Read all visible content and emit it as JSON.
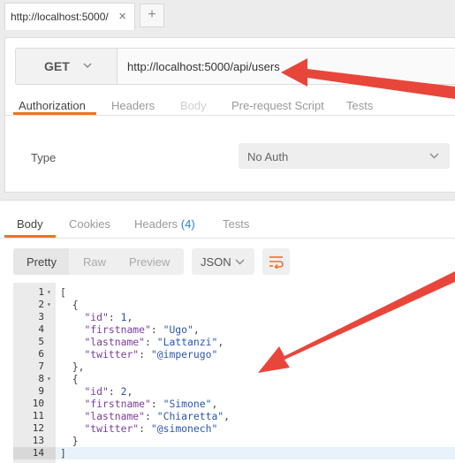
{
  "browser_tab": {
    "title": "http://localhost:5000/",
    "close": "×",
    "add": "+"
  },
  "request": {
    "method": "GET",
    "url": "http://localhost:5000/api/users",
    "tabs": [
      "Authorization",
      "Headers",
      "Body",
      "Pre-request Script",
      "Tests"
    ],
    "active_tab": "Authorization",
    "auth": {
      "type_label": "Type",
      "value": "No Auth"
    }
  },
  "response": {
    "tabs": {
      "body": "Body",
      "cookies": "Cookies",
      "headers": "Headers",
      "headers_count": "(4)",
      "tests": "Tests"
    },
    "active_tab": "Body",
    "view_modes": [
      "Pretty",
      "Raw",
      "Preview"
    ],
    "active_view": "Pretty",
    "format": "JSON",
    "lines": [
      {
        "n": "1",
        "text": "["
      },
      {
        "n": "2",
        "text": "  {"
      },
      {
        "n": "3",
        "key": "\"id\"",
        "val": "1",
        "tail": ","
      },
      {
        "n": "4",
        "key": "\"firstname\"",
        "val": "\"Ugo\"",
        "tail": ","
      },
      {
        "n": "5",
        "key": "\"lastname\"",
        "val": "\"Lattanzi\"",
        "tail": ","
      },
      {
        "n": "6",
        "key": "\"twitter\"",
        "val": "\"@imperugo\"",
        "tail": ""
      },
      {
        "n": "7",
        "text": "  },"
      },
      {
        "n": "8",
        "text": "  {"
      },
      {
        "n": "9",
        "key": "\"id\"",
        "val": "2",
        "tail": ","
      },
      {
        "n": "10",
        "key": "\"firstname\"",
        "val": "\"Simone\"",
        "tail": ","
      },
      {
        "n": "11",
        "key": "\"lastname\"",
        "val": "\"Chiaretta\"",
        "tail": ","
      },
      {
        "n": "12",
        "key": "\"twitter\"",
        "val": "\"@simonech\"",
        "tail": ""
      },
      {
        "n": "13",
        "text": "  }"
      },
      {
        "n": "14",
        "text": "]"
      }
    ]
  },
  "colors": {
    "accent": "#f47023",
    "arrow": "#e8463b",
    "link": "#2a7fd3"
  },
  "icons": [
    "chevron-down-icon",
    "wrap-lines-icon",
    "fold-arrow-icon",
    "red-arrow-annotation"
  ]
}
